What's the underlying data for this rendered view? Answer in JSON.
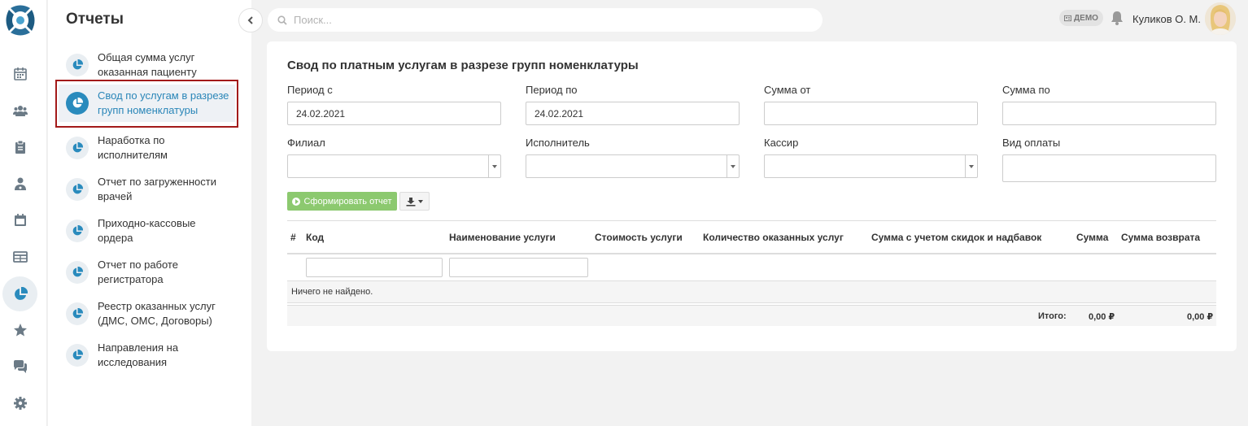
{
  "rail": {
    "items": [
      {
        "icon": "calendar-icon"
      },
      {
        "icon": "users-icon"
      },
      {
        "icon": "clipboard-icon"
      },
      {
        "icon": "doctor-icon"
      },
      {
        "icon": "schedule-icon"
      },
      {
        "icon": "table-icon"
      },
      {
        "icon": "reports-pie-icon",
        "active": true
      },
      {
        "icon": "star-icon"
      },
      {
        "icon": "chat-icon"
      },
      {
        "icon": "settings-gear-icon"
      }
    ]
  },
  "submenu": {
    "title": "Отчеты",
    "items": [
      {
        "label": "Общая сумма услуг\nоказанная пациенту"
      },
      {
        "label": "Свод по услугам в разрезе\nгрупп номенклатуры",
        "active": true
      },
      {
        "label": "Наработка по\nисполнителям"
      },
      {
        "label": "Отчет по загруженности\nврачей"
      },
      {
        "label": "Приходно-кассовые\nордера"
      },
      {
        "label": "Отчет по работе\nрегистратора"
      },
      {
        "label": "Реестр оказанных услуг\n(ДМС, ОМС, Договоры)"
      },
      {
        "label": "Направления на\nисследования"
      }
    ]
  },
  "topbar": {
    "search_placeholder": "Поиск...",
    "demo_label": "ДЕМО",
    "user_name": "Куликов О. М."
  },
  "report": {
    "title": "Свод по платным услугам в разрезе групп номенклатуры",
    "fields": {
      "period_from_label": "Период с",
      "period_from_value": "24.02.2021",
      "period_to_label": "Период по",
      "period_to_value": "24.02.2021",
      "sum_from_label": "Сумма от",
      "sum_from_value": "",
      "sum_to_label": "Сумма по",
      "sum_to_value": "",
      "branch_label": "Филиал",
      "executor_label": "Исполнитель",
      "cashier_label": "Кассир",
      "payment_type_label": "Вид оплаты",
      "payment_type_value": ""
    },
    "generate_button": "Сформировать отчет",
    "table": {
      "columns": [
        "#",
        "Код",
        "Наименование услуги",
        "Стоимость услуги",
        "Количество оказанных услуг",
        "Сумма с учетом скидок и надбавок",
        "Сумма",
        "Сумма возврата"
      ],
      "empty_text": "Ничего не найдено.",
      "total_label": "Итого:",
      "total_sum": "0,00 ₽",
      "total_return": "0,00 ₽"
    }
  },
  "colors": {
    "accent": "#2a8bbd",
    "generate_button": "#8cc96f",
    "selection_frame": "#a31a1a"
  }
}
